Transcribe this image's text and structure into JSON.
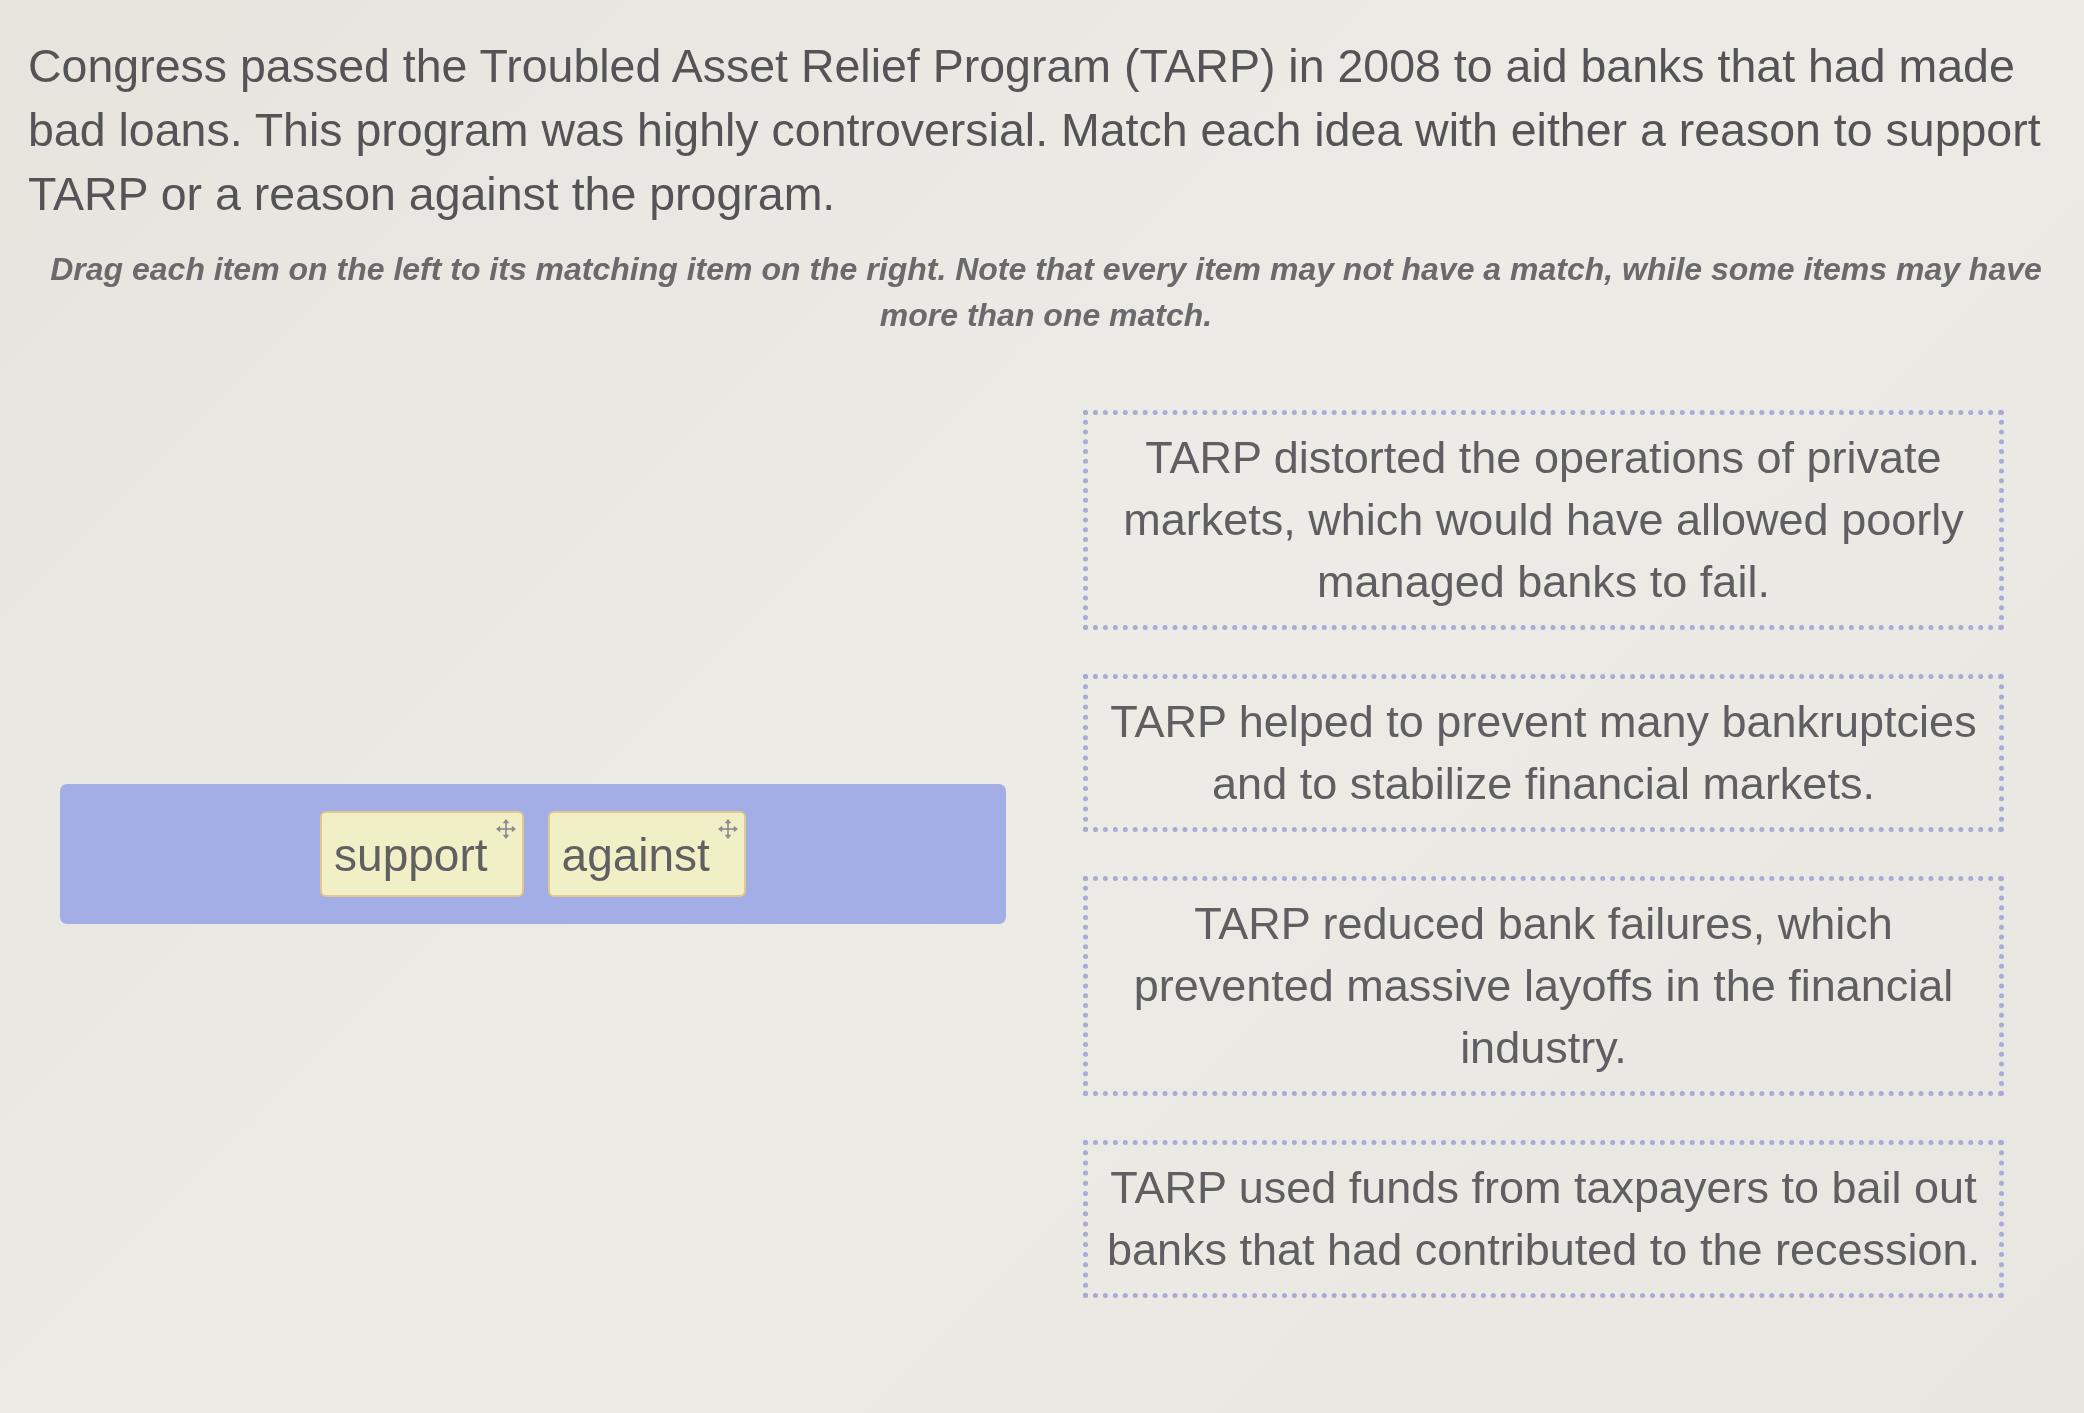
{
  "question": {
    "prompt": "Congress passed the Troubled Asset Relief Program (TARP) in 2008 to aid banks that had made bad loans. This program was highly controversial. Match each idea with either a reason to support TARP or a reason against the program.",
    "instructions": "Drag each item on the left to its matching item on the right. Note that every item may not have a match, while some items may have more than one match."
  },
  "answer_bank": {
    "items": [
      {
        "label": "support"
      },
      {
        "label": "against"
      }
    ]
  },
  "targets": [
    {
      "text": "TARP distorted the operations of private markets, which would have allowed poorly managed banks to fail."
    },
    {
      "text": "TARP helped to prevent many bankruptcies and to stabilize financial markets."
    },
    {
      "text": "TARP reduced bank failures, which prevented massive layoffs in the financial industry."
    },
    {
      "text": "TARP used funds from taxpayers to bail out banks that had contributed to the recession."
    }
  ]
}
